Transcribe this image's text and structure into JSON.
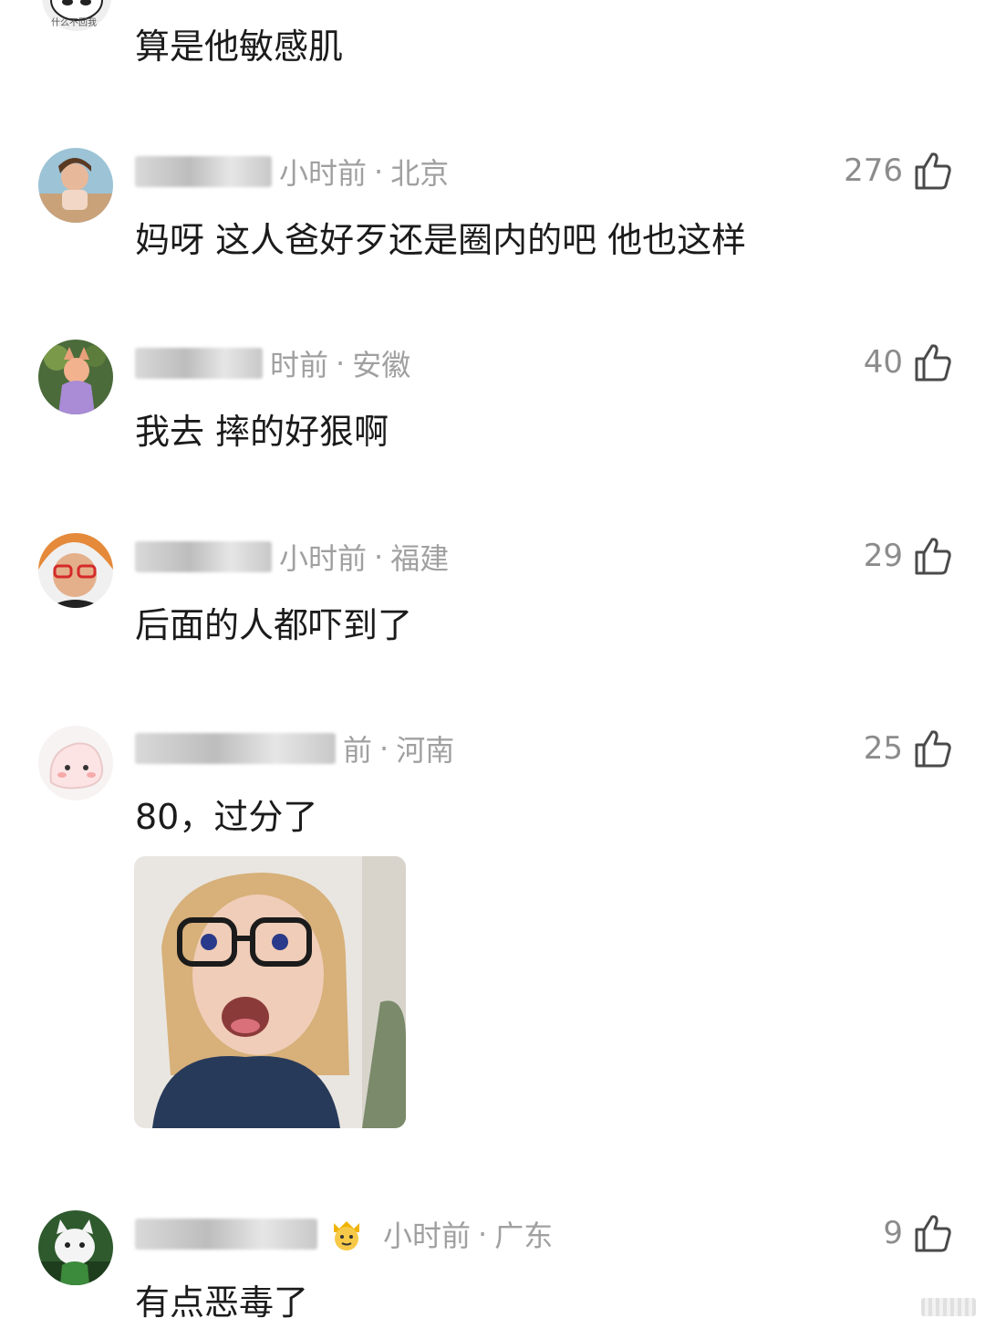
{
  "top_comment": {
    "avatar_caption": "什么不回我",
    "text": "算是他敏感肌"
  },
  "comments": [
    {
      "time": "小时前",
      "location": "北京",
      "likes": "276",
      "text": "妈呀 这人爸好歹还是圈内的吧 他也这样"
    },
    {
      "time": "时前",
      "location": "安徽",
      "likes": "40",
      "text": "我去 摔的好狠啊"
    },
    {
      "time": "小时前",
      "location": "福建",
      "likes": "29",
      "text": "后面的人都吓到了"
    },
    {
      "time": "前",
      "location": "河南",
      "likes": "25",
      "text": "80，过分了"
    },
    {
      "time": "小时前",
      "location": "广东",
      "likes": "9",
      "text": "有点恶毒了"
    }
  ],
  "separator": "·",
  "icons": {
    "like": "thumbs-up-icon"
  }
}
